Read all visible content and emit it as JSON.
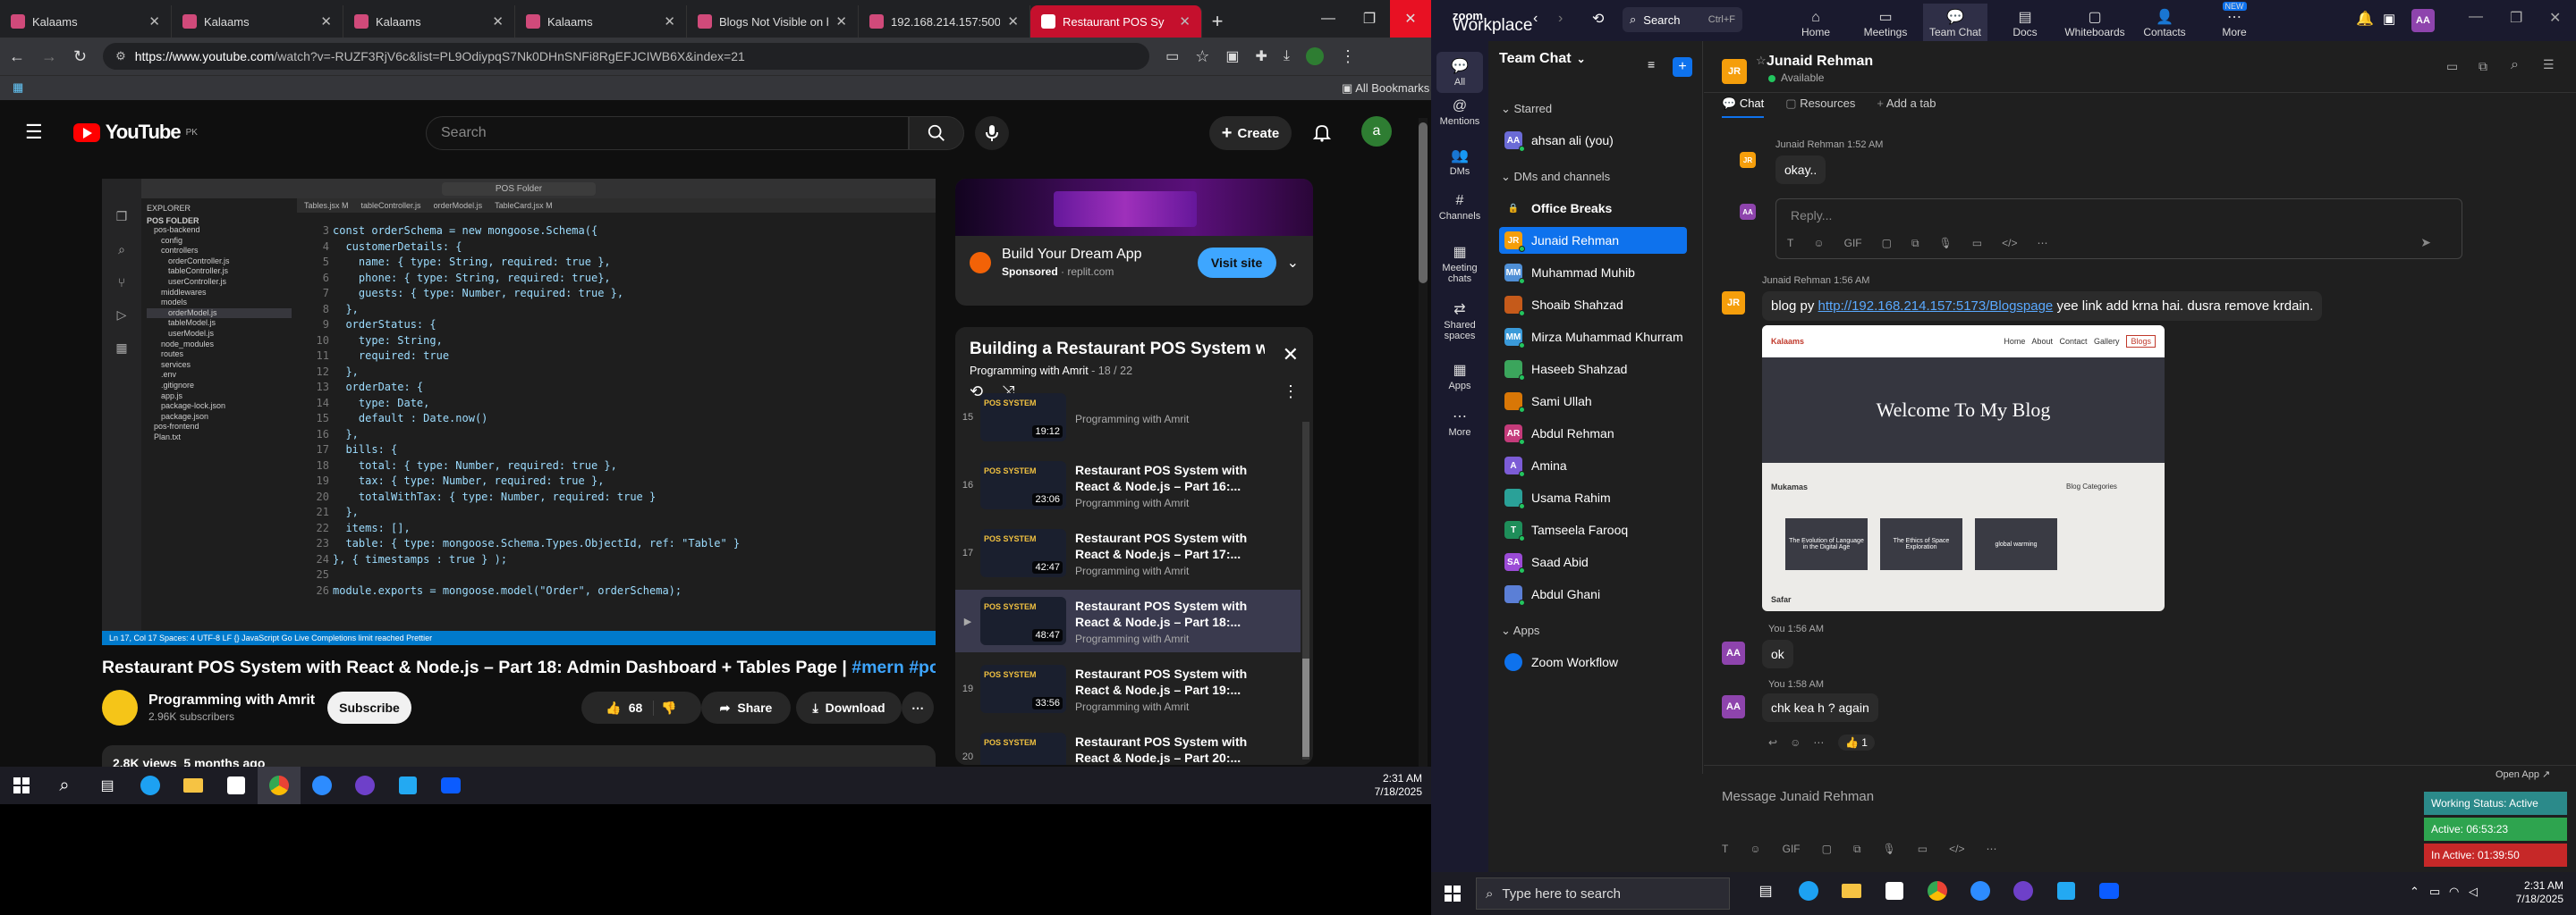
{
  "chrome": {
    "tabs": [
      {
        "title": "Kalaams",
        "active": false
      },
      {
        "title": "Kalaams",
        "active": false
      },
      {
        "title": "Kalaams",
        "active": false
      },
      {
        "title": "Kalaams",
        "active": false
      },
      {
        "title": "Blogs Not Visible on h",
        "active": false
      },
      {
        "title": "192.168.214.157:5000/",
        "active": false
      },
      {
        "title": "Restaurant POS Sy",
        "active": true
      }
    ],
    "url_host": "https://www.youtube.com",
    "url_path": "/watch?v=-RUZF3RjV6c&list=PL9OdiypqS7Nk0DHnSNFi8RgEFJCIWB6X&index=21",
    "all_bookmarks": "All Bookmarks"
  },
  "youtube": {
    "logo": "YouTube",
    "logo_region": "PK",
    "search_placeholder": "Search",
    "create_label": "Create",
    "avatar_letter": "a",
    "video_title_main": "Restaurant POS System with React & Node.js – Part 18: Admin Dashboard + Tables Page | ",
    "video_title_tags": "#mern #pos",
    "channel_name": "Programming with Amrit",
    "channel_subs": "2.96K subscribers",
    "subscribe_label": "Subscribe",
    "like_count": "68",
    "share_label": "Share",
    "download_label": "Download",
    "views": "2.8K views",
    "age": "5 months ago",
    "ad": {
      "title": "Build Your Dream App",
      "sponsor": "Sponsored",
      "domain": "replit.com",
      "visit_label": "Visit site"
    },
    "playlist": {
      "title": "Building a Restaurant POS System w...",
      "channel": "Programming with Amrit",
      "position": "18 / 22",
      "items": [
        {
          "idx": "15",
          "title": "",
          "channel": "Programming with Amrit",
          "duration": "19:12",
          "current": false
        },
        {
          "idx": "16",
          "title": "Restaurant POS System with React & Node.js – Part 16:...",
          "channel": "Programming with Amrit",
          "duration": "23:06",
          "current": false
        },
        {
          "idx": "17",
          "title": "Restaurant POS System with React & Node.js – Part 17:...",
          "channel": "Programming with Amrit",
          "duration": "42:47",
          "current": false
        },
        {
          "idx": "▶",
          "title": "Restaurant POS System with React & Node.js – Part 18:...",
          "channel": "Programming with Amrit",
          "duration": "48:47",
          "current": true
        },
        {
          "idx": "19",
          "title": "Restaurant POS System with React & Node.js – Part 19:...",
          "channel": "Programming with Amrit",
          "duration": "33:56",
          "current": false
        },
        {
          "idx": "20",
          "title": "Restaurant POS System with React & Node.js – Part 20:...",
          "channel": "Programming with Amrit",
          "duration": "47:59",
          "current": false
        }
      ]
    },
    "thumb_label": "POS SYSTEM",
    "code_lines": [
      "const orderSchema = new mongoose.Schema({",
      "  customerDetails: {",
      "    name: { type: String, required: true },",
      "    phone: { type: String, required: true},",
      "    guests: { type: Number, required: true },",
      "  },",
      "  orderStatus: {",
      "    type: String,",
      "    required: true",
      "  },",
      "  orderDate: {",
      "    type: Date,",
      "    default : Date.now()",
      "  },",
      "  bills: {",
      "    total: { type: Number, required: true },",
      "    tax: { type: Number, required: true },",
      "    totalWithTax: { type: Number, required: true }",
      "  },",
      "  items: [],",
      "  table: { type: mongoose.Schema.Types.ObjectId, ref: \"Table\" }",
      "}, { timestamps : true } );",
      "",
      "module.exports = mongoose.model(\"Order\", orderSchema);"
    ],
    "explorer": {
      "header": "EXPLORER",
      "root": "POS FOLDER",
      "items": [
        "pos-backend",
        "config",
        "controllers",
        "orderController.js",
        "tableController.js",
        "userController.js",
        "middlewares",
        "models",
        "orderModel.js",
        "tableModel.js",
        "userModel.js",
        "node_modules",
        "routes",
        "services",
        ".env",
        ".gitignore",
        "app.js",
        "package-lock.json",
        "package.json",
        "pos-frontend",
        "Plan.txt"
      ]
    },
    "editor_tabs": [
      "Tables.jsx M",
      "tableController.js",
      "orderModel.js",
      "TableCard.jsx M"
    ],
    "editor_search": "POS Folder",
    "status_text": "Ln 17, Col 17   Spaces: 4   UTF-8   LF   {} JavaScript   Go Live   Completions limit reached   Prettier"
  },
  "left_taskbar": {
    "time": "2:31 AM",
    "date": "7/18/2025"
  },
  "zoom": {
    "brand_top": "zoom",
    "brand_bottom": "Workplace",
    "search_label": "Search",
    "search_shortcut": "Ctrl+F",
    "nav": [
      {
        "label": "Home",
        "active": false
      },
      {
        "label": "Meetings",
        "active": false
      },
      {
        "label": "Team Chat",
        "active": true
      },
      {
        "label": "Docs",
        "active": false
      },
      {
        "label": "Whiteboards",
        "active": false
      },
      {
        "label": "Contacts",
        "active": false
      },
      {
        "label": "More",
        "active": false
      }
    ],
    "new_badge": "NEW",
    "rail": [
      "All",
      "Mentions",
      "DMs",
      "Channels",
      "Meeting chats",
      "Shared spaces",
      "Apps",
      "More"
    ],
    "list_title": "Team Chat",
    "sections": {
      "starred": "Starred",
      "dms": "DMs and channels",
      "apps": "Apps"
    },
    "starred": [
      {
        "name": "ahsan ali (you)",
        "initials": "AA",
        "color": "#6b6bd6"
      }
    ],
    "contacts": [
      {
        "name": "Office Breaks",
        "initials": "",
        "color": "#1f1f1f",
        "active": false
      },
      {
        "name": "Junaid Rehman",
        "initials": "JR",
        "color": "#f59e0b",
        "active": true
      },
      {
        "name": "Muhammad Muhib",
        "initials": "MM",
        "color": "#4f8fd6",
        "active": false
      },
      {
        "name": "Shoaib Shahzad",
        "initials": "",
        "color": "#c55a1a",
        "active": false
      },
      {
        "name": "Mirza Muhammad Khurram",
        "initials": "MM",
        "color": "#3a9ad9",
        "active": false
      },
      {
        "name": "Haseeb Shahzad",
        "initials": "",
        "color": "#3ba55c",
        "active": false
      },
      {
        "name": "Sami Ullah",
        "initials": "",
        "color": "#d97706",
        "active": false
      },
      {
        "name": "Abdul Rehman",
        "initials": "AR",
        "color": "#c43b7a",
        "active": false
      },
      {
        "name": "Amina",
        "initials": "A",
        "color": "#7c5cd6",
        "active": false
      },
      {
        "name": "Usama Rahim",
        "initials": "",
        "color": "#2aa198",
        "active": false
      },
      {
        "name": "Tamseela Farooq",
        "initials": "T",
        "color": "#1e8e5a",
        "active": false
      },
      {
        "name": "Saad Abid",
        "initials": "SA",
        "color": "#9b4bd6",
        "active": false
      },
      {
        "name": "Abdul Ghani",
        "initials": "",
        "color": "#5b7fd6",
        "active": false
      }
    ],
    "apps": [
      {
        "name": "Zoom Workflow"
      }
    ],
    "chat": {
      "name": "Junaid Rehman",
      "status": "Available",
      "initials": "JR",
      "tabs": [
        "Chat",
        "Resources",
        "Add a tab"
      ],
      "m1_meta": "Junaid Rehman 1:52 AM",
      "m1_text": "okay..",
      "reply_placeholder": "Reply...",
      "m2_meta": "Junaid Rehman 1:56 AM",
      "m2_prefix": "blog py ",
      "m2_link": "http://192.168.214.157:5173/Blogspage",
      "m2_suffix": " yee link add krna hai. dusra remove krdain.",
      "shot_brand": "Kalaams",
      "shot_nav": "Home   About   Contact   Gallery",
      "shot_nav_btn": "Blogs",
      "shot_hero": "Welcome To My Blog",
      "shot_cats": "Blog Categories",
      "shot_post": "Mukamas",
      "shot_cards": [
        "The Evolution of Language in the Digital Age",
        "The Ethics of Space Exploration",
        "global warming"
      ],
      "shot_footer": "Safar",
      "m3_meta": "You 1:56 AM",
      "m3_text": "ok",
      "m4_meta": "You 1:58 AM",
      "m4_text": "chk kea h ? again",
      "reaction": "👍 1",
      "my_initials": "AA",
      "compose_placeholder": "Message Junaid Rehman"
    },
    "open_app": "Open App ↗",
    "work_status": [
      {
        "label": "Working Status: Active",
        "color": "#2b8a8a"
      },
      {
        "label": "Active: 06:53:23",
        "color": "#2ea44f"
      },
      {
        "label": "In Active: 01:39:50",
        "color": "#c62828"
      }
    ]
  },
  "right_taskbar": {
    "search_placeholder": "Type here to search",
    "time": "2:31 AM",
    "date": "7/18/2025"
  }
}
